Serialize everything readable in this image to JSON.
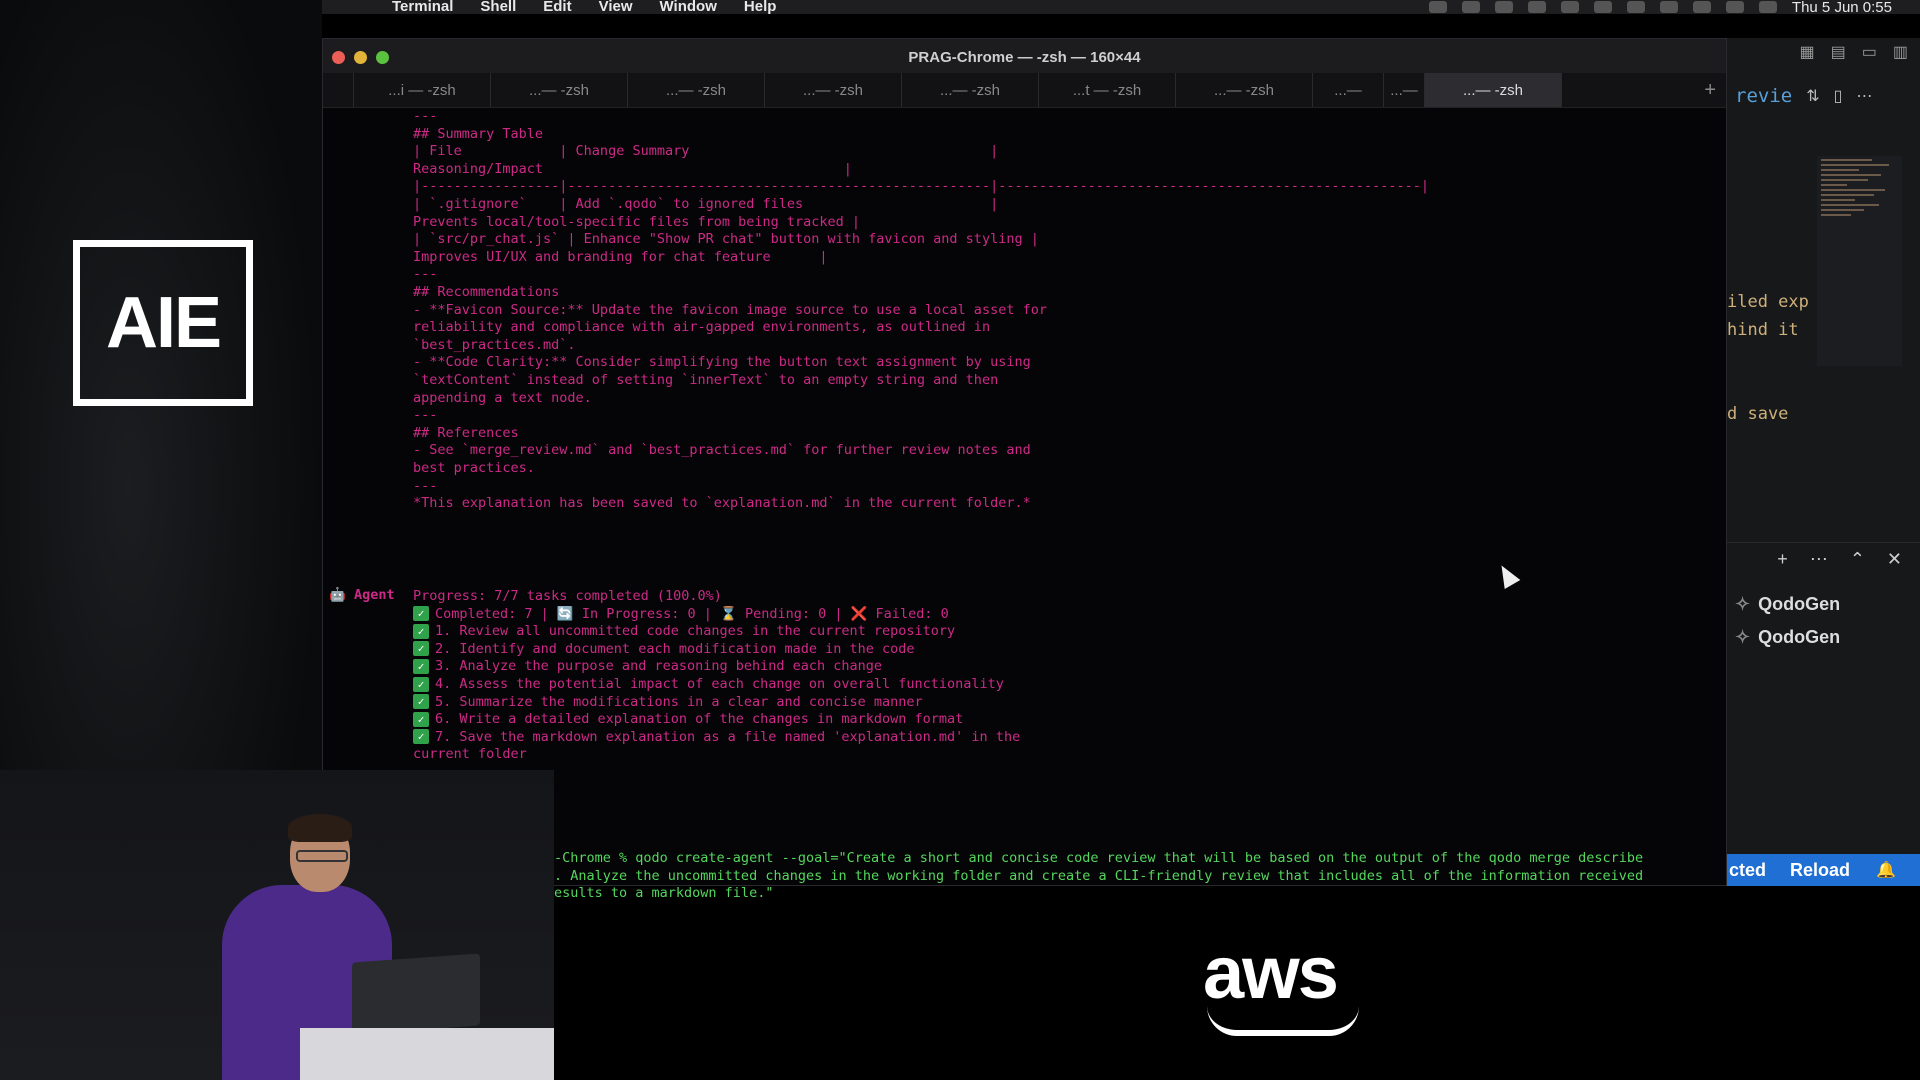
{
  "menubar": {
    "app": "Terminal",
    "items": [
      "Shell",
      "Edit",
      "View",
      "Window",
      "Help"
    ],
    "clock": "Thu 5 Jun 0:55"
  },
  "branding": {
    "event_logo": "AIE",
    "sponsor_logo": "aws"
  },
  "terminal": {
    "title": "PRAG-Chrome — -zsh — 160×44",
    "tabs": [
      {
        "label": "...i — -zsh"
      },
      {
        "label": "...— -zsh"
      },
      {
        "label": "...— -zsh"
      },
      {
        "label": "...— -zsh"
      },
      {
        "label": "...— -zsh"
      },
      {
        "label": "...t — -zsh"
      },
      {
        "label": "...— -zsh"
      },
      {
        "label": "...—"
      },
      {
        "label": "...—"
      },
      {
        "label": "...— -zsh"
      }
    ],
    "output_lines": [
      "---",
      "## Summary Table",
      "| File            | Change Summary                                     |",
      "Reasoning/Impact                                     |",
      "|-----------------|----------------------------------------------------|----------------------------------------------------|",
      "| `.gitignore`    | Add `.qodo` to ignored files                       |",
      "Prevents local/tool-specific files from being tracked |",
      "| `src/pr_chat.js` | Enhance \"Show PR chat\" button with favicon and styling |",
      "Improves UI/UX and branding for chat feature      |",
      "---",
      "## Recommendations",
      "- **Favicon Source:** Update the favicon image source to use a local asset for",
      "reliability and compliance with air-gapped environments, as outlined in",
      "`best_practices.md`.",
      "- **Code Clarity:** Consider simplifying the button text assignment by using",
      "`textContent` instead of setting `innerText` to an empty string and then",
      "appending a text node.",
      "---",
      "## References",
      "- See `merge_review.md` and `best_practices.md` for further review notes and",
      "best practices.",
      "---",
      "*This explanation has been saved to `explanation.md` in the current folder.*"
    ],
    "agent_label": "Agent",
    "progress": "Progress: 7/7 tasks completed (100.0%)",
    "status_line": "Completed: 7 | 🔄 In Progress: 0 | ⌛ Pending: 0 | ❌ Failed: 0",
    "tasks": [
      "1. Review all uncommitted code changes in the current repository",
      "2. Identify and document each modification made in the code",
      "3. Analyze the purpose and reasoning behind each change",
      "4. Assess the potential impact of each change on overall functionality",
      "5. Summarize the modifications in a clear and concise manner",
      "6. Write a detailed explanation of the changes in markdown format",
      "7. Save the markdown explanation as a file named 'explanation.md' in the"
    ],
    "task_wrap": "current folder",
    "command_lines": [
      "-Chrome % qodo create-agent --goal=\"Create a short and concise code review that will be based on the output of the qodo merge describe",
      ". Analyze the uncommitted changes in the working folder and create a CLI-friendly review that includes all of the information received",
      "esults to a markdown file.\""
    ]
  },
  "vscode": {
    "toolbar_text": "revie",
    "code_peek": [
      "iled exp",
      "hind it",
      "",
      "",
      "d save"
    ],
    "panel_items": [
      "QodoGen",
      "QodoGen"
    ],
    "status": {
      "connected": "cted",
      "reload": "Reload"
    }
  }
}
